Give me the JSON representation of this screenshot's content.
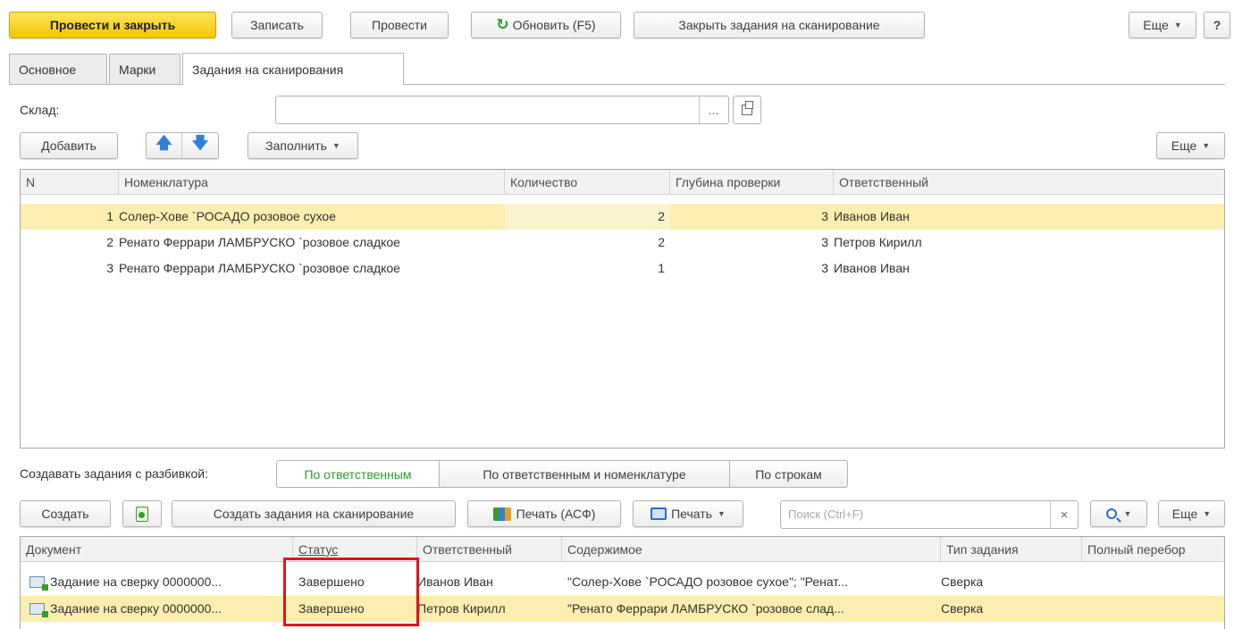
{
  "toolbar": {
    "post_close": "Провести и закрыть",
    "save": "Записать",
    "post": "Провести",
    "refresh": "Обновить (F5)",
    "close_tasks": "Закрыть задания на сканирование",
    "more": "Еще",
    "help": "?"
  },
  "tabs": [
    {
      "label": "Основное"
    },
    {
      "label": "Марки"
    },
    {
      "label": "Задания на сканирования"
    }
  ],
  "warehouse": {
    "label": "Склад:",
    "value": "",
    "select_btn": "...",
    "open_icon": "open-window-icon"
  },
  "table1_toolbar": {
    "add": "Добавить",
    "fill": "Заполнить",
    "more": "Еще",
    "up_icon": "arrow-up-icon",
    "down_icon": "arrow-down-icon"
  },
  "table1": {
    "columns": [
      "N",
      "Номенклатура",
      "Количество",
      "Глубина проверки",
      "Ответственный"
    ],
    "rows": [
      {
        "n": "1",
        "item": "Солер-Хове `РОСАДО розовое сухое",
        "qty": "2",
        "depth": "3",
        "resp": "Иванов Иван",
        "selected": true
      },
      {
        "n": "2",
        "item": "Ренато Феррари ЛАМБРУСКО `розовое сладкое",
        "qty": "2",
        "depth": "3",
        "resp": "Петров Кирилл",
        "selected": false
      },
      {
        "n": "3",
        "item": "Ренато Феррари ЛАМБРУСКО `розовое сладкое",
        "qty": "1",
        "depth": "3",
        "resp": "Иванов Иван",
        "selected": false
      }
    ]
  },
  "split": {
    "label": "Создавать задания с разбивкой:",
    "options": [
      "По ответственным",
      "По ответственным и номенклатуре",
      "По строкам"
    ],
    "active": 0
  },
  "table2_toolbar": {
    "create": "Создать",
    "create_scan": "Создать задания на сканирование",
    "print_asf": "Печать (АСФ)",
    "print": "Печать",
    "search_placeholder": "Поиск (Ctrl+F)",
    "clear": "×",
    "more": "Еще"
  },
  "table2": {
    "columns": [
      "Документ",
      "Статус",
      "Ответственный",
      "Содержимое",
      "Тип задания",
      "Полный перебор"
    ],
    "rows": [
      {
        "doc": "Задание на сверку 0000000...",
        "status": "Завершено",
        "resp": "Иванов Иван",
        "content": "\"Солер-Хове `РОСАДО розовое сухое\"; \"Ренат...",
        "type": "Сверка",
        "full": "",
        "selected": false
      },
      {
        "doc": "Задание на сверку 0000000...",
        "status": "Завершено",
        "resp": "Петров Кирилл",
        "content": "\"Ренато Феррари ЛАМБРУСКО `розовое слад...",
        "type": "Сверка",
        "full": "",
        "selected": true
      }
    ]
  },
  "colors": {
    "primary": "#f3c600",
    "selection": "#fbeeb0",
    "highlight_box": "#e0141c",
    "active_toggle": "#2e9b2e",
    "arrow": "#2f80d8"
  }
}
